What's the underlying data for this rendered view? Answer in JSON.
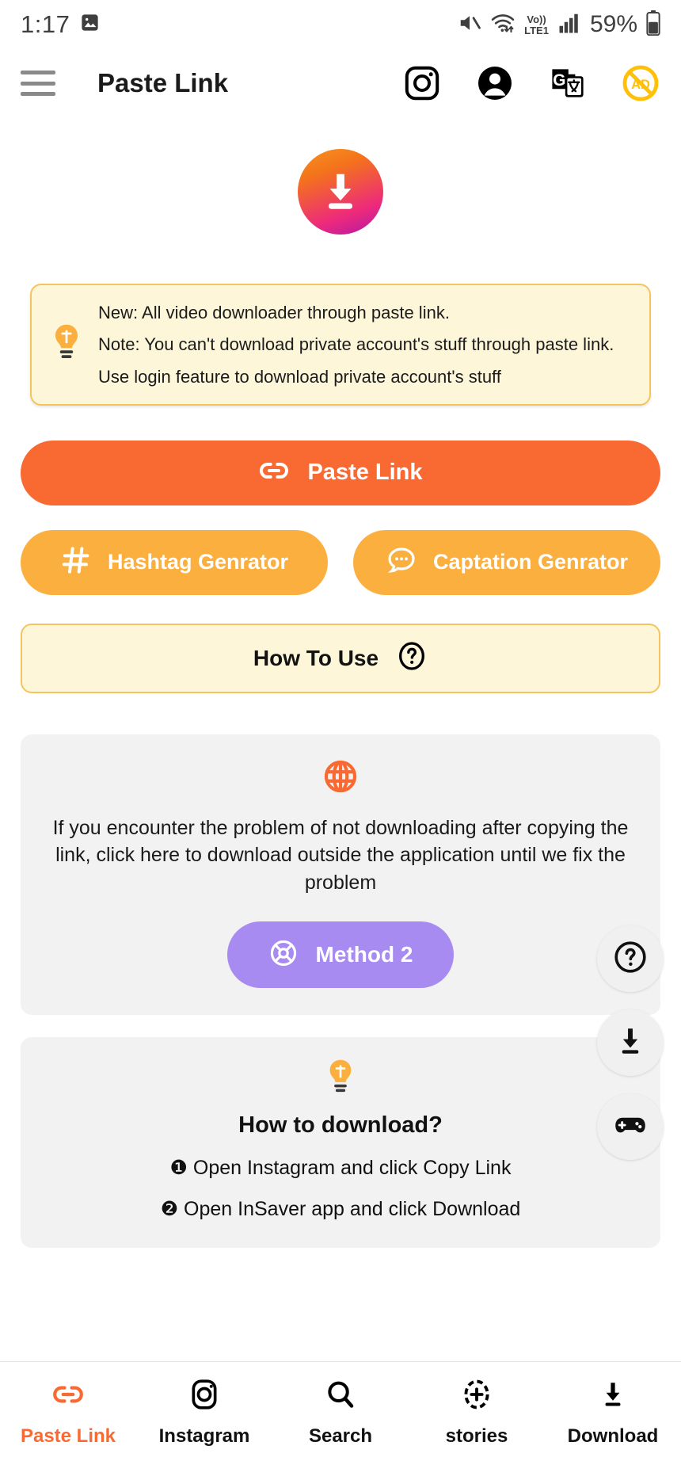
{
  "status_bar": {
    "time": "1:17",
    "image_icon": "image-icon",
    "mute_icon": "volume-mute-icon",
    "wifi_icon": "wifi-icon",
    "volte_top": "Vo))",
    "volte_bottom": "LTE1",
    "signal_icon": "cellular-signal-icon",
    "battery_percent": "59%",
    "battery_icon": "battery-icon"
  },
  "app_bar": {
    "menu_icon": "hamburger-menu-icon",
    "title": "Paste Link",
    "instagram_icon": "instagram-icon",
    "account_icon": "account-circle-icon",
    "translate_icon": "google-translate-icon",
    "ad_icon": "no-ads-icon",
    "ad_label": "AD"
  },
  "hero": {
    "logo_icon": "download-arrow-logo",
    "gradient_from": "#f7941e",
    "gradient_to": "#b118a8"
  },
  "notice": {
    "bulb_icon": "lightbulb-icon",
    "lines": [
      "New: All video downloader through paste link.",
      "Note: You can't download private account's stuff through paste link.",
      "Use login feature to download private account's stuff"
    ],
    "bg_color": "#fdf6d9",
    "border_color": "#f5c45e"
  },
  "paste_button": {
    "icon": "link-icon",
    "label": "Paste Link",
    "color": "#f96a33"
  },
  "generator_buttons": [
    {
      "icon": "hashtag-icon",
      "label": "Hashtag Genrator",
      "color": "#fbaf3f"
    },
    {
      "icon": "chat-bubble-icon",
      "label": "Captation Genrator",
      "color": "#fbaf3f"
    }
  ],
  "how_to_use": {
    "label": "How To Use",
    "icon": "question-mark-circle-icon"
  },
  "method_panel": {
    "globe_icon": "globe-icon",
    "globe_color": "#f96a33",
    "text": "If you encounter the problem of not downloading after copying the link, click here to download outside the application until we fix the problem",
    "button": {
      "icon": "compass-icon",
      "label": "Method 2",
      "color": "#a78bf0"
    }
  },
  "how_download_panel": {
    "bulb_icon": "lightbulb-icon",
    "title": "How to download?",
    "steps": [
      "❶ Open Instagram and click Copy Link",
      "❷ Open InSaver app and click Download"
    ]
  },
  "fabs": [
    {
      "icon": "question-mark-circle-icon",
      "name": "help-fab"
    },
    {
      "icon": "download-icon",
      "name": "download-fab"
    },
    {
      "icon": "game-controller-icon",
      "name": "games-fab"
    }
  ],
  "bottom_nav": {
    "active_color": "#f96a33",
    "items": [
      {
        "icon": "link-icon",
        "label": "Paste Link",
        "active": true
      },
      {
        "icon": "instagram-icon",
        "label": "Instagram",
        "active": false
      },
      {
        "icon": "search-icon",
        "label": "Search",
        "active": false
      },
      {
        "icon": "add-story-icon",
        "label": "stories",
        "active": false
      },
      {
        "icon": "download-icon",
        "label": "Download",
        "active": false
      }
    ]
  }
}
